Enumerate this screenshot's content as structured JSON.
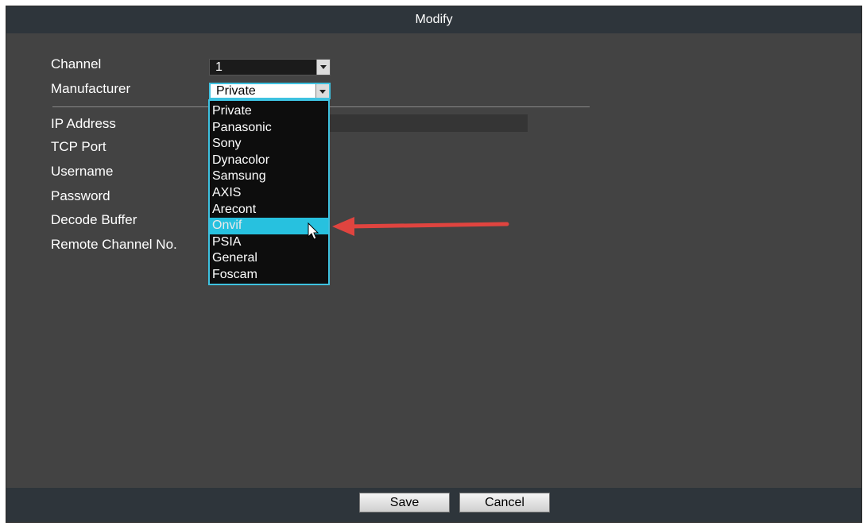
{
  "dialog": {
    "title": "Modify",
    "labels": {
      "channel": "Channel",
      "manufacturer": "Manufacturer",
      "ip_address": "IP Address",
      "tcp_port": "TCP Port",
      "username": "Username",
      "password": "Password",
      "decode_buffer": "Decode Buffer",
      "remote_channel": "Remote Channel No."
    },
    "channel_value": "1",
    "manufacturer_value": "Private",
    "dropdown_options": [
      "Private",
      "Panasonic",
      "Sony",
      "Dynacolor",
      "Samsung",
      "AXIS",
      "Arecont",
      "Onvif",
      "PSIA",
      "General",
      "Foscam"
    ],
    "highlighted_option": "Onvif",
    "buttons": {
      "save": "Save",
      "cancel": "Cancel"
    }
  },
  "colors": {
    "dialog_bg": "#434343",
    "titlebar_bg": "#2e353b",
    "highlight": "#27c1df",
    "annotation_arrow": "#e0443f"
  }
}
